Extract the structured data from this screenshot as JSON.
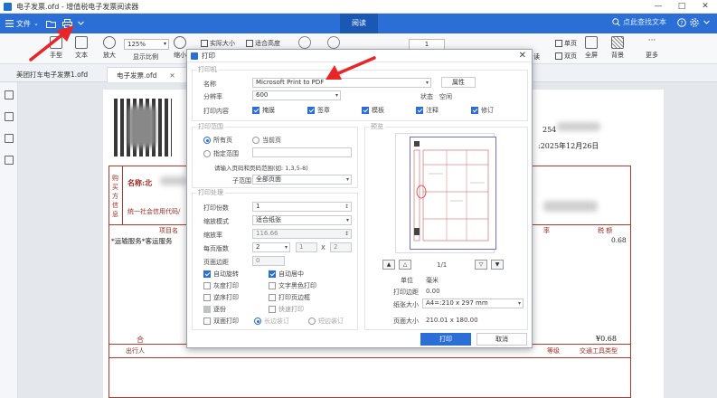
{
  "window": {
    "title": "电子发票.ofd - 增值税电子发票阅读器"
  },
  "menubar": {
    "file_label": "文件",
    "read_tab": "阅读",
    "search_placeholder": "点此查找文本"
  },
  "toolbar": {
    "hand": "手型",
    "text": "文本",
    "zoom_in": "放大",
    "zoom_ratio_label": "显示比例",
    "zoom_out": "缩小",
    "zoom_value": "125%",
    "actual_size": "实际大小",
    "fit_height": "适合高度",
    "page_value": "1",
    "single_page": "单页",
    "double_page": "双页",
    "read_suffix": "读",
    "fullscreen": "全屏",
    "background": "背景",
    "more": "更多"
  },
  "tabs": [
    {
      "label": "美团打车电子发票1.ofd"
    },
    {
      "label": "电子发票.ofd"
    }
  ],
  "invoice": {
    "buyer_vertical": "购买方信息",
    "name_label": "名称:北",
    "tax_id_label": "统一社会信用代码/",
    "number_prefix": "254",
    "date": ":2025年12月26日",
    "item_header": "项目名",
    "item_row": "*运输服务*客运服务",
    "price_header": "率",
    "tax_header": "税    额",
    "tax_value": "0.68",
    "total_label": "合",
    "total_value": "¥0.68",
    "passenger_label": "出行人",
    "level_label": "等级",
    "vehicle_label": "交通工具类型"
  },
  "dialog": {
    "title": "打印",
    "printer_group": "打印机",
    "name_label": "名称",
    "printer_value": "Microsoft Print to PDF",
    "properties_btn": "属性",
    "resolution_label": "分辨率",
    "resolution_value": "600",
    "status_label": "状态",
    "status_value": "空闲",
    "content_label": "打印内容",
    "content_items": [
      "掩膜",
      "签章",
      "模板",
      "注释",
      "修订"
    ],
    "range_group": "打印范围",
    "all_pages": "所有页",
    "current_page": "当前页",
    "specific_range": "指定范围",
    "range_hint": "请输入页码和页码范围(如: 1,3,5-8)",
    "subrange_label": "子范围",
    "subrange_value": "全部页面",
    "process_group": "打印处理",
    "copies_label": "打印份数",
    "copies_value": "1",
    "scale_mode_label": "缩放模式",
    "scale_mode_value": "适合纸张",
    "scale_ratio_label": "缩放率",
    "scale_ratio_value": "116.66",
    "pages_per_sheet_label": "每页版数",
    "pps_a": "2",
    "pps_b": "1",
    "pps_x": "X",
    "pps_c": "2",
    "margin_label": "页面边距",
    "margin_value": "0",
    "auto_rotate": "自动旋转",
    "auto_center": "自动居中",
    "grayscale": "灰度打印",
    "text_black": "文字黑色打印",
    "reverse": "逆序打印",
    "print_border": "打印页边框",
    "collate": "逐份",
    "fast_print": "快速打印",
    "duplex": "双面打印",
    "long_edge": "长边装订",
    "short_edge": "短边装订",
    "preview_group": "预览",
    "page_indicator": "1/1",
    "unit_label": "单位",
    "unit_value": "毫米",
    "print_margin_label": "打印边距",
    "print_margin_value": "0.00",
    "paper_size_label": "纸张大小",
    "paper_size_value": "A4=:210 x 297 mm",
    "page_size_label": "页面大小",
    "page_size_value": "210.01 x 180.00",
    "print_btn": "打印",
    "cancel_btn": "取消"
  }
}
